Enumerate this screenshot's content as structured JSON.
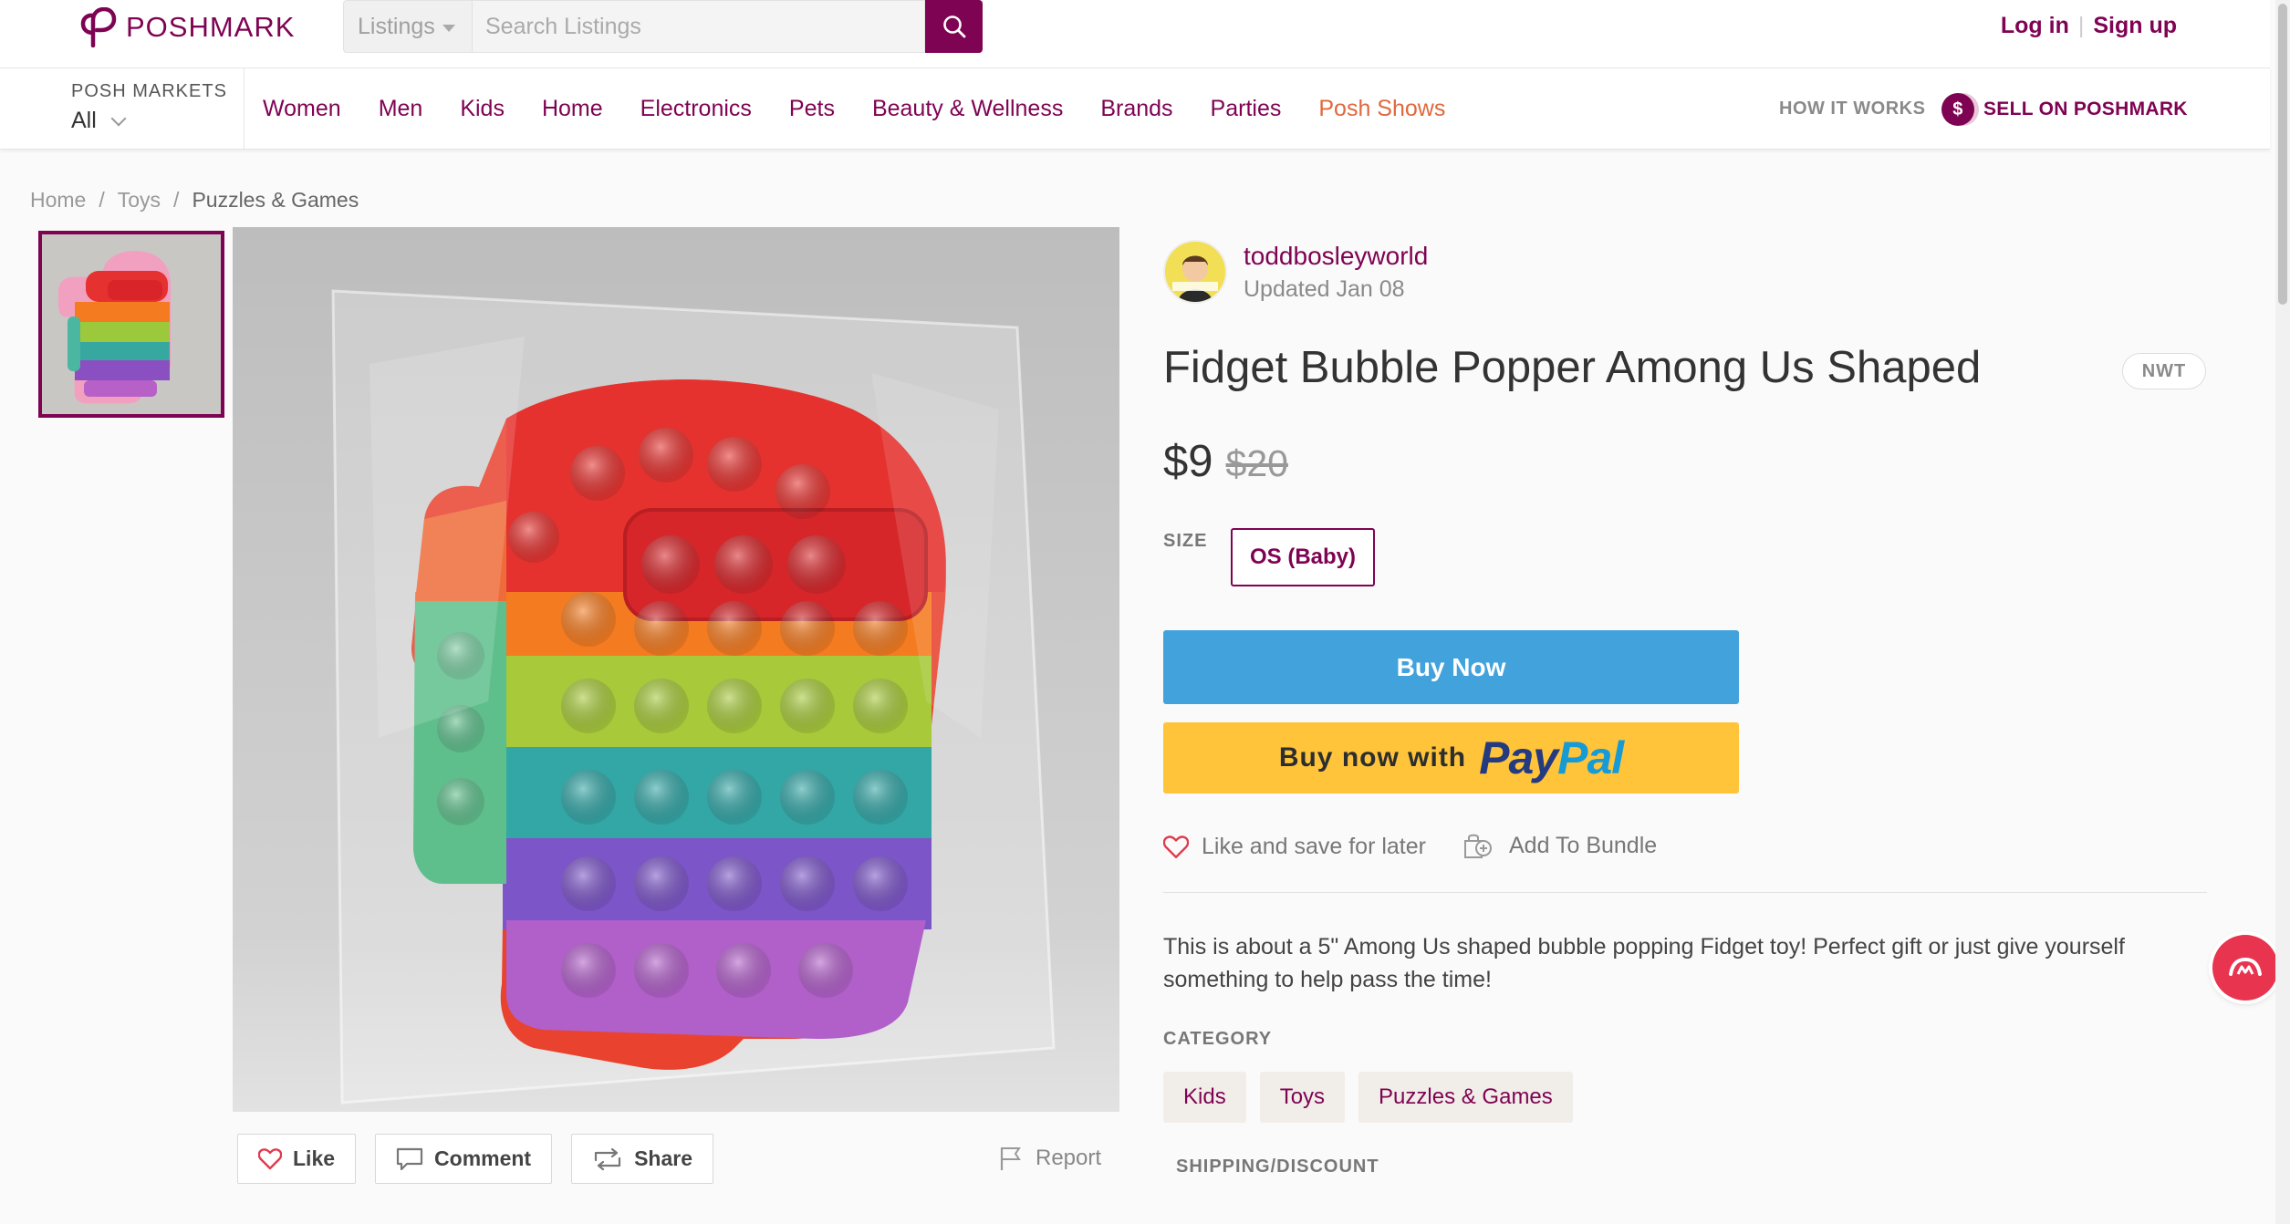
{
  "header": {
    "brand": "POSHMARK",
    "search_scope": "Listings",
    "search_placeholder": "Search Listings",
    "login": "Log in",
    "signup": "Sign up"
  },
  "nav": {
    "markets_label": "POSH MARKETS",
    "markets_value": "All",
    "links": [
      "Women",
      "Men",
      "Kids",
      "Home",
      "Electronics",
      "Pets",
      "Beauty & Wellness",
      "Brands",
      "Parties",
      "Posh Shows"
    ],
    "how_it_works": "HOW IT WORKS",
    "sell": "SELL ON POSHMARK",
    "sell_icon": "$"
  },
  "breadcrumb": [
    "Home",
    "Toys",
    "Puzzles & Games"
  ],
  "listing": {
    "seller": "toddbosleyworld",
    "updated": "Updated Jan 08",
    "title": "Fidget Bubble Popper Among Us Shaped",
    "condition": "NWT",
    "price": "$9",
    "original_price": "$20",
    "size_label": "SIZE",
    "size": "OS (Baby)",
    "buy_now": "Buy Now",
    "paypal_prefix": "Buy now with",
    "paypal_brand_1": "Pay",
    "paypal_brand_2": "Pal",
    "like_save": "Like and save for later",
    "add_bundle": "Add To Bundle",
    "description": "This is about a 5\" Among Us shaped bubble popping Fidget toy! Perfect gift or just give yourself something to help pass the time!",
    "category_label": "CATEGORY",
    "categories": [
      "Kids",
      "Toys",
      "Puzzles & Games"
    ],
    "shipping_label": "SHIPPING/DISCOUNT"
  },
  "image_actions": {
    "like": "Like",
    "comment": "Comment",
    "share": "Share",
    "report": "Report"
  },
  "colors": {
    "brand": "#7f0353",
    "posh_shows": "#e0683d",
    "buy_now": "#42a2dc",
    "paypal": "#ffc439"
  }
}
